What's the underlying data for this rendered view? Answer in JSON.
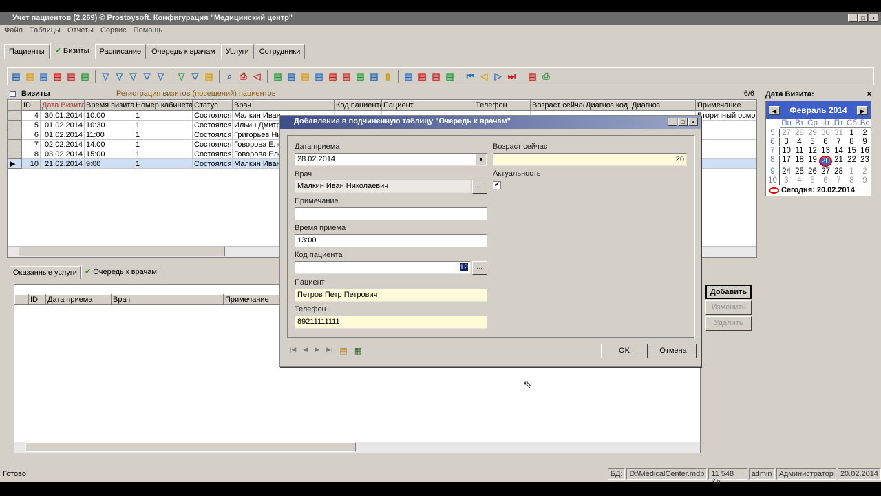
{
  "window": {
    "title": "Учет пациентов (2.269) © Prostoysoft. Конфигурация \"Медицинский центр\""
  },
  "menu": [
    "Файл",
    "Таблицы",
    "Отчеты",
    "Сервис",
    "Помощь"
  ],
  "tabs": [
    "Пациенты",
    "Визиты",
    "Расписание",
    "Очередь к врачам",
    "Услуги",
    "Сотрудники"
  ],
  "toolbar_icons": [
    "add-record-icon",
    "edit-icon",
    "copy-icon",
    "delete-icon",
    "delete-table-icon",
    "refresh-icon",
    "filter-icon",
    "filter-remove-icon",
    "filter-clear-icon",
    "filter-yellow-icon",
    "filter-save-icon",
    "filter-advanced-icon",
    "filter-tree-icon",
    "sql-icon",
    "find-icon",
    "print-icon",
    "preview-icon",
    "export-word-icon",
    "export-excel-icon",
    "word-icon",
    "excel-icon",
    "export-icon",
    "export-html-icon",
    "export-csv-icon",
    "export-txt-icon",
    "chart-icon",
    "import-icon",
    "import2-icon",
    "columns-icon",
    "table-settings-icon",
    "first-icon",
    "prev-icon",
    "next-icon",
    "last-icon",
    "spellcheck-icon",
    "printer-icon"
  ],
  "visits": {
    "title": "Визиты",
    "subtitle": "Регистрация визитов (посещений) пациентов",
    "count": "6/6",
    "columns": [
      "ID",
      "Дата Визита",
      "Время визита",
      "Номер кабинета",
      "Статус",
      "Врач",
      "Код пациента",
      "Пациент",
      "Телефон",
      "Возраст сейчас",
      "Диагноз код",
      "Диагноз",
      "Примечание"
    ],
    "rows": [
      [
        "4",
        "30.01.2014",
        "10:00",
        "1",
        "Состоялся",
        "Малкин Иван",
        "",
        "",
        "",
        "",
        "",
        "",
        "Вторичный осмот"
      ],
      [
        "5",
        "01.02.2014",
        "10:30",
        "1",
        "Состоялся",
        "Ильин Дмитри",
        "",
        "",
        "",
        "",
        "",
        "",
        ""
      ],
      [
        "6",
        "01.02.2014",
        "11:00",
        "1",
        "Состоялся",
        "Григорьев Ни",
        "",
        "",
        "",
        "",
        "",
        "",
        ""
      ],
      [
        "7",
        "02.02.2014",
        "14:00",
        "1",
        "Состоялся",
        "Говорова Еле",
        "",
        "",
        "",
        "",
        "",
        "",
        ""
      ],
      [
        "8",
        "03.02.2014",
        "15:00",
        "1",
        "Состоялся",
        "Говорова Еле",
        "",
        "",
        "",
        "",
        "",
        "",
        ""
      ],
      [
        "10",
        "21.02.2014",
        "9:00",
        "1",
        "Состоялся",
        "Малкин Иван",
        "",
        "",
        "",
        "",
        "",
        "",
        ""
      ]
    ]
  },
  "subtabs": [
    "Оказанные услуги",
    "Очередь к врачам"
  ],
  "queue": {
    "columns": [
      "ID",
      "Дата приема",
      "Врач",
      "Примечание"
    ]
  },
  "side_buttons": {
    "add": "Добавить",
    "edit": "Изменить",
    "delete": "Удалить"
  },
  "calendar": {
    "title": "Дата Визита:",
    "month": "Февраль 2014",
    "days": [
      "Пн",
      "Вт",
      "Ср",
      "Чт",
      "Пт",
      "Сб",
      "Вс"
    ],
    "weeks": [
      [
        "5",
        "27",
        "28",
        "29",
        "30",
        "31",
        "1",
        "2"
      ],
      [
        "6",
        "3",
        "4",
        "5",
        "6",
        "7",
        "8",
        "9"
      ],
      [
        "7",
        "10",
        "11",
        "12",
        "13",
        "14",
        "15",
        "16"
      ],
      [
        "8",
        "17",
        "18",
        "19",
        "20",
        "21",
        "22",
        "23"
      ],
      [
        "9",
        "24",
        "25",
        "26",
        "27",
        "28",
        "1",
        "2"
      ],
      [
        "10",
        "3",
        "4",
        "5",
        "6",
        "7",
        "8",
        "9"
      ]
    ],
    "today": "Сегодня: 20.02.2014"
  },
  "dialog": {
    "title": "Добавление в подчиненную таблицу \"Очередь к врачам\"",
    "date_label": "Дата приема",
    "date": "28.02.2014",
    "doctor_label": "Врач",
    "doctor": "Малкин Иван Николаевич",
    "note_label": "Примечание",
    "note": "",
    "time_label": "Время приема",
    "time": "13:00",
    "code_label": "Код пациента",
    "code": "12",
    "patient_label": "Пациент",
    "patient": "Петров Петр Петрович",
    "phone_label": "Телефон",
    "phone": "89211111111",
    "age_label": "Возраст сейчас",
    "age": "26",
    "active_label": "Актуальность",
    "active": true,
    "ok": "OK",
    "cancel": "Отмена",
    "browse": "..."
  },
  "status": {
    "text": "Готово",
    "db_label": "БД:",
    "db": "D:\\MedicalCenter.mdb",
    "size": "11 548 Kb",
    "user": "admin",
    "role": "Администратор",
    "date": "20.02.2014"
  }
}
